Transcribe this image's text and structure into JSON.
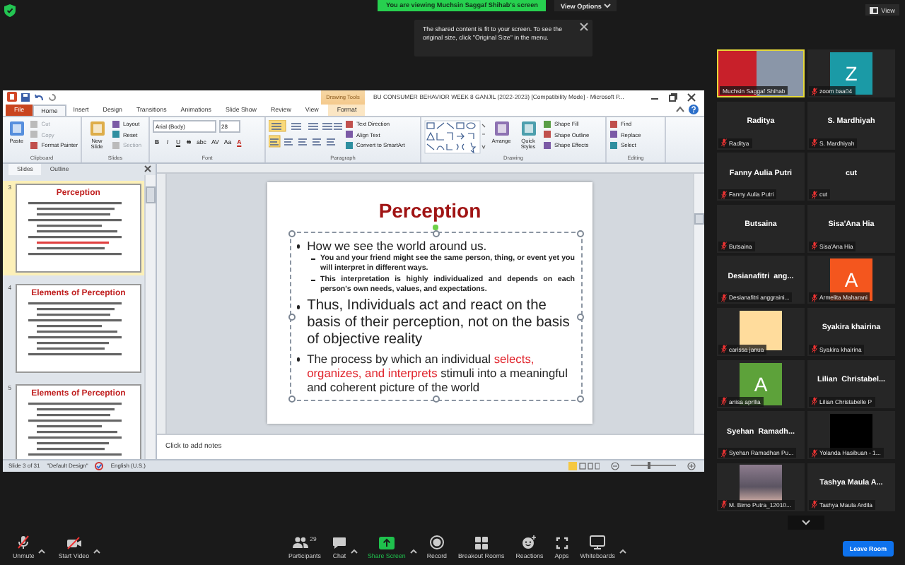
{
  "top_bar": {
    "banner": "You are viewing Muchsin Saggaf Shihab's screen",
    "view_options": "View Options",
    "view": "View"
  },
  "notice": {
    "text": "The shared content is fit to your screen. To see the original size, click \"Original Size\" in the menu."
  },
  "app_window": {
    "title": "BU CONSUMER BEHAVIOR WEEK 8 GANJIL (2022-2023) [Compatibility Mode] - Microsoft P...",
    "context_label": "Drawing Tools",
    "tabs": [
      {
        "label": "File",
        "kind": "file",
        "selected": false
      },
      {
        "label": "Home",
        "kind": "tab",
        "selected": true
      },
      {
        "label": "Insert",
        "kind": "tab",
        "selected": false
      },
      {
        "label": "Design",
        "kind": "tab",
        "selected": false
      },
      {
        "label": "Transitions",
        "kind": "tab",
        "selected": false
      },
      {
        "label": "Animations",
        "kind": "tab",
        "selected": false
      },
      {
        "label": "Slide Show",
        "kind": "tab",
        "selected": false
      },
      {
        "label": "Review",
        "kind": "tab",
        "selected": false
      },
      {
        "label": "View",
        "kind": "tab",
        "selected": false
      },
      {
        "label": "Format",
        "kind": "context",
        "selected": false
      }
    ],
    "ribbon": [
      {
        "label": "Clipboard",
        "kind": "clipboard",
        "items": [
          {
            "label": "Paste",
            "kind": "large",
            "disabled": false
          },
          {
            "label": "Cut",
            "kind": "small",
            "disabled": true
          },
          {
            "label": "Copy",
            "kind": "small",
            "disabled": true
          },
          {
            "label": "Format Painter",
            "kind": "small",
            "disabled": false
          }
        ]
      },
      {
        "label": "Slides",
        "kind": "slides",
        "items": [
          {
            "label": "New Slide",
            "kind": "large",
            "disabled": false
          },
          {
            "label": "Layout",
            "kind": "small",
            "disabled": false
          },
          {
            "label": "Reset",
            "kind": "small",
            "disabled": false
          },
          {
            "label": "Section",
            "kind": "small",
            "disabled": true
          }
        ]
      },
      {
        "label": "Font",
        "kind": "font",
        "items": [
          {
            "label": "Arial (Body)",
            "kind": "field"
          },
          {
            "label": "28",
            "kind": "field"
          },
          {
            "label": "B",
            "kind": "glyph"
          },
          {
            "label": "I",
            "kind": "glyph"
          },
          {
            "label": "U",
            "kind": "glyph"
          },
          {
            "label": "S",
            "kind": "glyph"
          },
          {
            "label": "abc",
            "kind": "glyph"
          },
          {
            "label": "AV",
            "kind": "glyph"
          },
          {
            "label": "Aa",
            "kind": "glyph"
          },
          {
            "label": "A",
            "kind": "glyph"
          }
        ]
      },
      {
        "label": "Paragraph",
        "kind": "paragraph",
        "items": [
          {
            "label": "Text Direction",
            "kind": "small",
            "disabled": false
          },
          {
            "label": "Align Text",
            "kind": "small",
            "disabled": false
          },
          {
            "label": "Convert to SmartArt",
            "kind": "small",
            "disabled": false
          }
        ]
      },
      {
        "label": "Drawing",
        "kind": "drawing",
        "items": [
          {
            "label": "Arrange",
            "kind": "large",
            "disabled": false
          },
          {
            "label": "Quick Styles",
            "kind": "large",
            "disabled": false
          },
          {
            "label": "Shape Fill",
            "kind": "small",
            "disabled": false
          },
          {
            "label": "Shape Outline",
            "kind": "small",
            "disabled": false
          },
          {
            "label": "Shape Effects",
            "kind": "small",
            "disabled": false
          }
        ]
      },
      {
        "label": "Editing",
        "kind": "editing",
        "items": [
          {
            "label": "Find",
            "kind": "small",
            "disabled": false
          },
          {
            "label": "Replace",
            "kind": "small",
            "disabled": false
          },
          {
            "label": "Select",
            "kind": "small",
            "disabled": false
          }
        ]
      }
    ],
    "slides_pane": {
      "tabs": [
        {
          "label": "Slides",
          "selected": true
        },
        {
          "label": "Outline",
          "selected": false
        }
      ],
      "thumbnails": [
        {
          "number": "3",
          "title": "Perception",
          "selected": true
        },
        {
          "number": "4",
          "title": "Elements of Perception",
          "selected": false
        },
        {
          "number": "5",
          "title": "Elements of Perception",
          "selected": false
        }
      ]
    },
    "slide": {
      "title": "Perception",
      "bullets": [
        {
          "segments": [
            {
              "text": "How we see the world around us.",
              "highlight": false
            }
          ],
          "children": [
            {
              "segments": [
                {
                  "text": "You and your friend might see the same person, thing, or event yet you will interpret in different ways.",
                  "highlight": false
                }
              ]
            },
            {
              "segments": [
                {
                  "text": "This interpretation is highly individualized and depends on each person's own needs, values, and expectations.",
                  "highlight": false
                }
              ]
            }
          ]
        },
        {
          "segments": [
            {
              "text": "Thus, Individuals act and react on the basis of their perception, not on the basis of objective reality",
              "highlight": false
            }
          ]
        },
        {
          "segments": [
            {
              "text": "The process by which an individual ",
              "highlight": false
            },
            {
              "text": "selects, organizes, and interprets",
              "highlight": true
            },
            {
              "text": " stimuli into a meaningful and coherent picture of the world",
              "highlight": false
            }
          ]
        }
      ]
    },
    "notes": {
      "placeholder": "Click to add notes"
    },
    "status_bar": {
      "texts": [
        "Slide 3 of 31",
        "\"Default Design\"",
        "English (U.S.)"
      ],
      "zoom": {
        "level": 0.4
      }
    }
  },
  "gallery": {
    "tiles": [
      {
        "name": "Muchsin Saggaf Shihab",
        "kind": "video",
        "speaking": true,
        "muted": false
      },
      {
        "name": "zoom baa04",
        "kind": "avatar",
        "letter": "Z",
        "color": "#1b9aa6",
        "speaking": false,
        "muted": true
      },
      {
        "name": "Raditya",
        "kind": "name",
        "display": "Raditya",
        "speaking": false,
        "muted": true
      },
      {
        "name": "S. Mardhiyah",
        "kind": "name",
        "display": "S. Mardhiyah",
        "speaking": false,
        "muted": true
      },
      {
        "name": "Fanny Aulia Putri",
        "kind": "name",
        "display": "Fanny Aulia Putri",
        "speaking": false,
        "muted": true
      },
      {
        "name": "cut",
        "kind": "name",
        "display": "cut",
        "speaking": false,
        "muted": true
      },
      {
        "name": "Butsaina",
        "kind": "name",
        "display": "Butsaina",
        "speaking": false,
        "muted": true
      },
      {
        "name": "Sisa'Ana Hia",
        "kind": "name",
        "display": "Sisa'Ana Hia",
        "speaking": false,
        "muted": true
      },
      {
        "name": "Desianafitri anggraini...",
        "kind": "name",
        "display": "Desianafitri  ang...",
        "speaking": false,
        "muted": true
      },
      {
        "name": "Armelita Maharani",
        "kind": "avatar",
        "letter": "A",
        "color": "#f4561e",
        "speaking": false,
        "muted": true
      },
      {
        "name": "carissa janua",
        "kind": "picture",
        "color": "#ffdc9c",
        "speaking": false,
        "muted": true
      },
      {
        "name": "Syakira khairina",
        "kind": "name",
        "display": "Syakira khairina",
        "speaking": false,
        "muted": true
      },
      {
        "name": "anisa aprilia",
        "kind": "avatar",
        "letter": "A",
        "color": "#5da23a",
        "speaking": false,
        "muted": true
      },
      {
        "name": "Lilian Christabelle P",
        "kind": "name",
        "display": "Lilian  Christabel...",
        "speaking": false,
        "muted": true
      },
      {
        "name": "Syehan Ramadhan Pu...",
        "kind": "name",
        "display": "Syehan  Ramadh...",
        "speaking": false,
        "muted": true
      },
      {
        "name": "Yolanda Hasibuan - 1...",
        "kind": "picture",
        "color": "#000000",
        "speaking": false,
        "muted": true
      },
      {
        "name": "M. Bimo Putra_12010...",
        "kind": "photo",
        "speaking": false,
        "muted": true
      },
      {
        "name": "Tashya Maula Ardila",
        "kind": "name",
        "display": "Tashya Maula A...",
        "speaking": false,
        "muted": true
      }
    ]
  },
  "toolbar": {
    "buttons": [
      {
        "label": "Unmute",
        "kind": "mic",
        "caret": true
      },
      {
        "label": "Start Video",
        "kind": "video",
        "caret": true
      },
      {
        "label": "Participants",
        "kind": "participants",
        "count": "29"
      },
      {
        "label": "Chat",
        "kind": "chat",
        "caret": true
      },
      {
        "label": "Share Screen",
        "kind": "share",
        "caret": true
      },
      {
        "label": "Record",
        "kind": "record"
      },
      {
        "label": "Breakout Rooms",
        "kind": "breakout"
      },
      {
        "label": "Reactions",
        "kind": "reactions"
      },
      {
        "label": "Apps",
        "kind": "apps"
      },
      {
        "label": "Whiteboards",
        "kind": "whiteboard",
        "caret": true
      }
    ],
    "leave": "Leave Room"
  }
}
